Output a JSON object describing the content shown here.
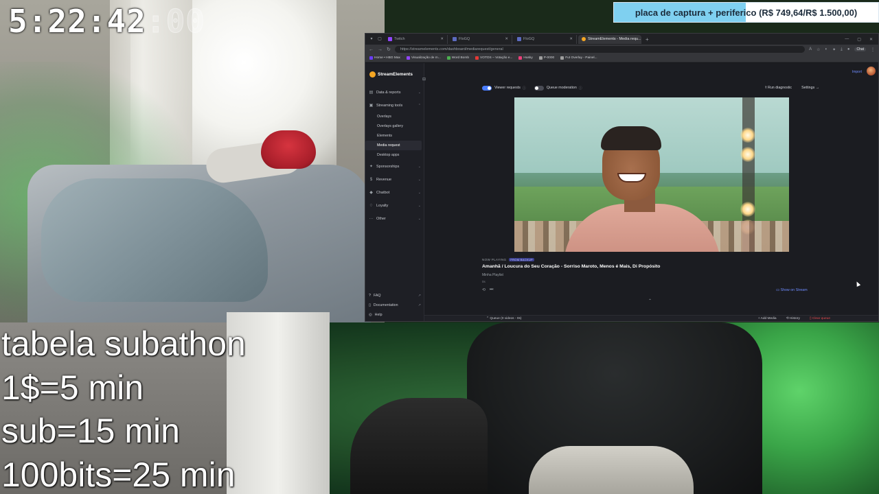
{
  "overlay": {
    "timer_main": "5:22:42",
    "timer_faded": ":00",
    "goal": {
      "label": "placa de captura + periferico (R$ 749,64/R$ 1.500,00)",
      "current": 749.64,
      "target": 1500.0,
      "fill_color": "#7fd0f0"
    },
    "subathon_lines": [
      "tabela subathon",
      "1$=5 min",
      "sub=15 min",
      "100bits=25 min"
    ]
  },
  "browser": {
    "tabs": [
      {
        "label": "Twitch",
        "icon": "twitch-icon",
        "color": "#9146ff",
        "active": false
      },
      {
        "label": "FloGQ",
        "icon": "page-icon",
        "color": "#5c6bc0",
        "active": false
      },
      {
        "label": "FloGQ",
        "icon": "page-icon",
        "color": "#5c6bc0",
        "active": false
      },
      {
        "label": "StreamElements - Media requ...",
        "icon": "streamelements-icon",
        "color": "#f5a623",
        "active": true
      }
    ],
    "new_tab": "+",
    "url": "https://streamelements.com/dashboard/mediarequest/general",
    "toolbar_chat": "Chat",
    "bookmarks": [
      {
        "label": "Home • HBO Max",
        "color": "#6a3cff"
      },
      {
        "label": "Visualização de m...",
        "color": "#9146ff"
      },
      {
        "label": "Word Bomb",
        "color": "#4caf50"
      },
      {
        "label": "VOTOS – Votação e...",
        "color": "#e53935"
      },
      {
        "label": "Husky",
        "color": "#ec407a"
      },
      {
        "label": "P-0000",
        "color": "#9e9e9e"
      },
      {
        "label": "Fut Overlay - Painel...",
        "color": "#9e9e9e"
      }
    ]
  },
  "streamelements": {
    "brand": "StreamElements",
    "nav": [
      {
        "label": "Data & reports",
        "icon": "chart-icon",
        "expanded": false
      },
      {
        "label": "Streaming tools",
        "icon": "tools-icon",
        "expanded": true
      }
    ],
    "streaming_tools_items": [
      "Overlays",
      "Overlays gallery",
      "Elements",
      "Media request",
      "Desktop apps"
    ],
    "active_item": "Media request",
    "nav_more": [
      {
        "label": "Sponsorships",
        "icon": "star-icon"
      },
      {
        "label": "Revenue",
        "icon": "dollar-icon"
      },
      {
        "label": "Chatbot",
        "icon": "chat-icon"
      },
      {
        "label": "Loyalty",
        "icon": "loyalty-icon"
      },
      {
        "label": "Other",
        "icon": "more-icon"
      }
    ],
    "footer": [
      "FAQ",
      "Documentation",
      "Help"
    ],
    "import_label": "Import",
    "viewer_requests_label": "Viewer requests",
    "viewer_requests_on": true,
    "queue_moderation_label": "Queue moderation",
    "queue_moderation_on": false,
    "run_diagnostic": "Run diagnostic",
    "settings": "Settings",
    "now_playing_label": "NOW PLAYING",
    "now_playing_badge": "FROM BACKUP",
    "song_title": "Amanhã / Loucura do Seu Coração - Sorriso Maroto, Menos é Mais, Di Propósito",
    "playlist": "Minha Playlist",
    "requester": "0s",
    "show_on_stream": "Show on Stream",
    "queue_label": "Queue (0 videos - 0s)",
    "add_media": "Add Media",
    "history": "History",
    "clear_queue": "Clear queue"
  }
}
